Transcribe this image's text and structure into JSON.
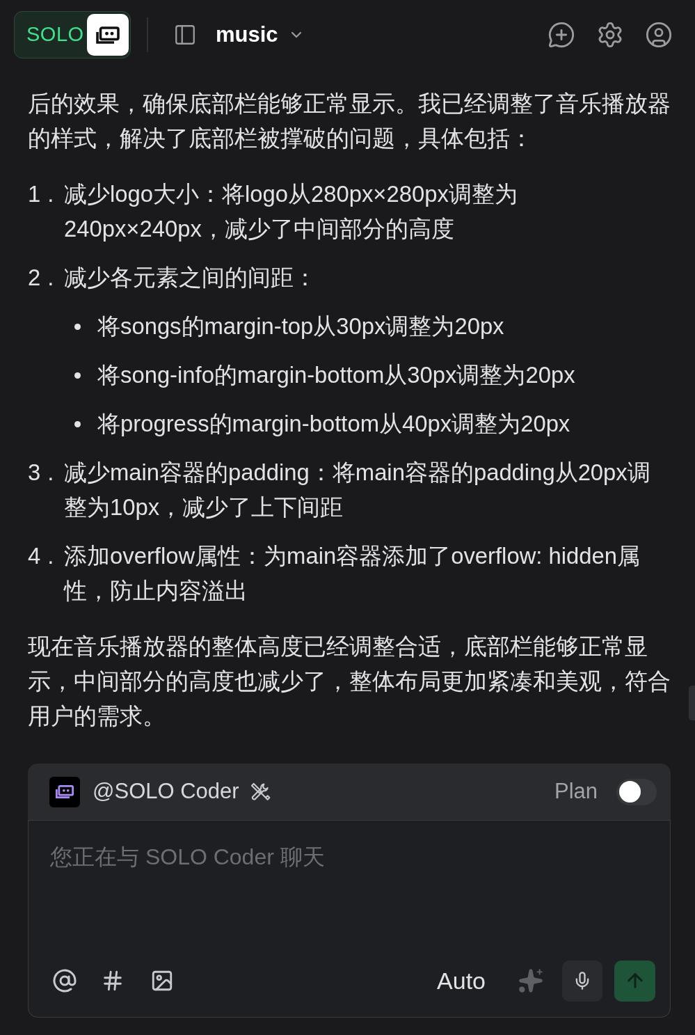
{
  "header": {
    "brand": "SOLO",
    "project": "music"
  },
  "message": {
    "intro": "后的效果，确保底部栏能够正常显示。我已经调整了音乐播放器的样式，解决了底部栏被撑破的问题，具体包括：",
    "steps": [
      {
        "marker": "1.",
        "text": "减少logo大小：将logo从280px×280px调整为240px×240px，减少了中间部分的高度"
      },
      {
        "marker": "2.",
        "text": "减少各元素之间的间距：",
        "children": [
          {
            "text": "将songs的margin-top从30px调整为20px"
          },
          {
            "text": "将song-info的margin-bottom从30px调整为20px"
          },
          {
            "text": "将progress的margin-bottom从40px调整为20px"
          }
        ]
      },
      {
        "marker": "3.",
        "text": "减少main容器的padding：将main容器的padding从20px调整为10px，减少了上下间距"
      },
      {
        "marker": "4.",
        "text": "添加overflow属性：为main容器添加了overflow: hidden属性，防止内容溢出"
      }
    ],
    "conclusion": "现在音乐播放器的整体高度已经调整合适，底部栏能够正常显示，中间部分的高度也减少了，整体布局更加紧凑和美观，符合用户的需求。"
  },
  "composer": {
    "agent": "@SOLO Coder",
    "plan": {
      "label": "Plan",
      "on": false
    },
    "placeholder": "您正在与 SOLO Coder 聊天",
    "mode": "Auto"
  }
}
